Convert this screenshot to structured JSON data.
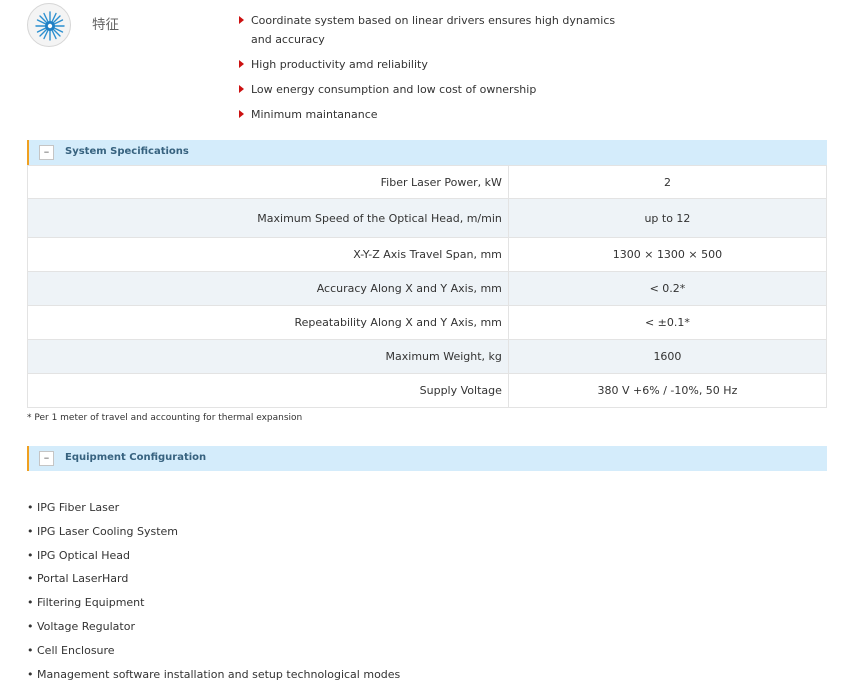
{
  "features": {
    "title": "特征",
    "icon": "laser-burst-icon",
    "items": [
      "Coordinate system based on linear drivers ensures high dynamics and accuracy",
      "High productivity amd reliability",
      "Low energy consumption and low cost of ownership",
      "Minimum maintanance"
    ]
  },
  "specifications": {
    "title": "System Specifications",
    "collapse_label": "–",
    "rows": [
      {
        "label": "Fiber Laser Power, kW",
        "value": "2"
      },
      {
        "label": "Maximum Speed of the Optical Head, m/min",
        "value": "up to 12"
      },
      {
        "label": "X-Y-Z Axis Travel Span, mm",
        "value": "1300 × 1300 × 500"
      },
      {
        "label": "Accuracy Along X and Y Axis, mm",
        "value": "< 0.2*"
      },
      {
        "label": "Repeatability Along X and Y Axis, mm",
        "value": "< ±0.1*"
      },
      {
        "label": "Maximum Weight, kg",
        "value": "1600"
      },
      {
        "label": "Supply Voltage",
        "value": "380 V +6% / -10%, 50 Hz"
      }
    ],
    "footnote": "* Per 1 meter of travel and accounting for thermal expansion"
  },
  "configuration": {
    "title": "Equipment Configuration",
    "collapse_label": "–",
    "items": [
      "IPG Fiber Laser",
      "IPG Laser Cooling System",
      "IPG Optical Head",
      "Portal LaserHard",
      "Filtering Equipment",
      "Voltage Regulator",
      "Cell Enclosure",
      "Management software installation and setup technological modes"
    ]
  },
  "colors": {
    "section_bar": "#d4ecfb",
    "section_accent": "#f0a020",
    "bullet_red": "#cc1111",
    "row_alt": "#eef3f7"
  }
}
